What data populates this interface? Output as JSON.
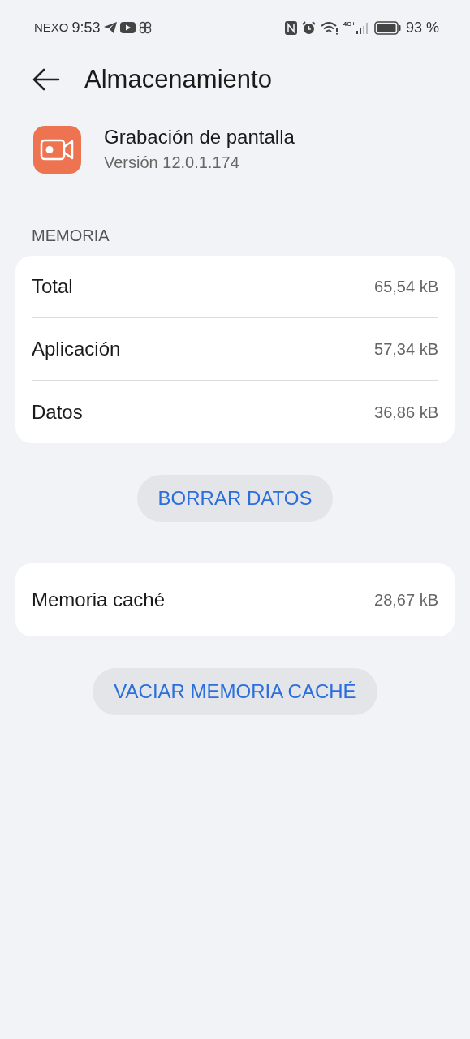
{
  "status_bar": {
    "carrier": "NEXO",
    "time": "9:53",
    "network": "4G+",
    "battery": "93 %"
  },
  "header": {
    "title": "Almacenamiento"
  },
  "app": {
    "name": "Grabación de pantalla",
    "version": "Versión 12.0.1.174"
  },
  "section_title": "MEMORIA",
  "memory_rows": [
    {
      "label": "Total",
      "value": "65,54 kB"
    },
    {
      "label": "Aplicación",
      "value": "57,34 kB"
    },
    {
      "label": "Datos",
      "value": "36,86 kB"
    }
  ],
  "clear_data_button": "BORRAR DATOS",
  "cache_row": {
    "label": "Memoria caché",
    "value": "28,67 kB"
  },
  "clear_cache_button": "VACIAR MEMORIA CACHÉ"
}
